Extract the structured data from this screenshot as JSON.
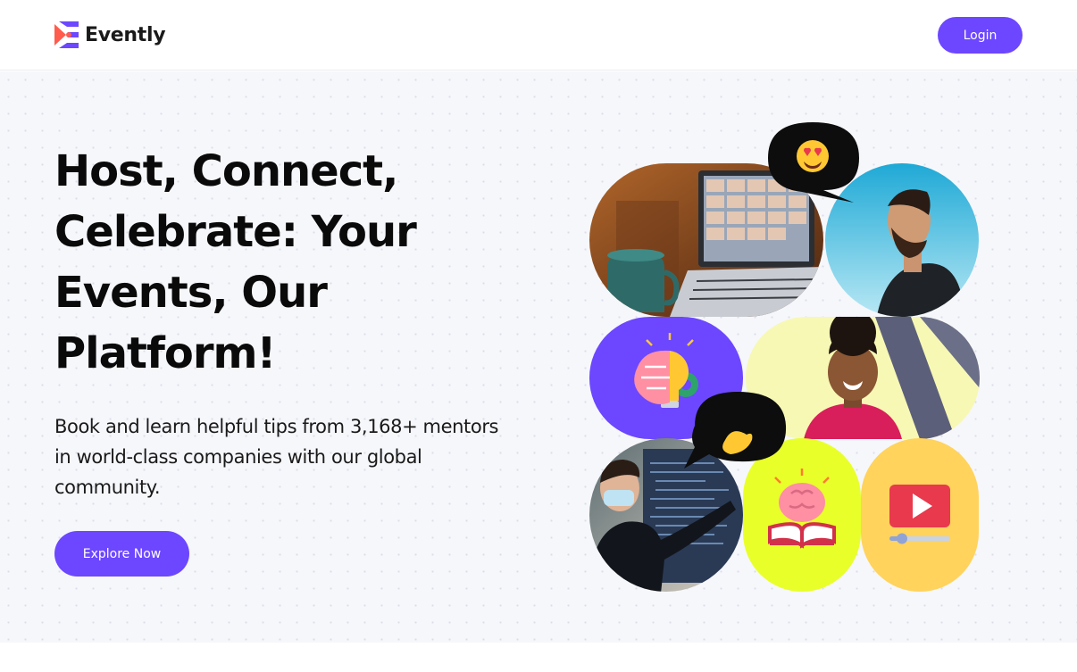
{
  "header": {
    "brand_name": "Evently",
    "login_label": "Login"
  },
  "hero": {
    "title": "Host, Connect, Celebrate: Your Events, Our Platform!",
    "subtitle": "Book and learn helpful tips from 3,168+ mentors in world-class companies with our global community.",
    "cta_label": "Explore Now"
  },
  "collage": {
    "tiles": [
      "photo-laptop-video-call",
      "photo-man-laughing",
      "brain-lightbulb-icon",
      "photo-woman-smiling",
      "photo-man-presenting",
      "brain-book-icon",
      "video-player-icon"
    ],
    "bubbles": [
      "heart-eyes-emoji",
      "pinched-fingers-emoji"
    ]
  },
  "colors": {
    "accent": "#6c47ff",
    "brand_red": "#ff5c4d",
    "brand_purple": "#6c47ff",
    "tile_purple": "#6c47ff",
    "tile_lime": "#e9ff2a",
    "tile_yellow": "#ffd35c",
    "tile_pale_yellow": "#f7f8b4",
    "tile_sky": "#2bbbe0",
    "bubble": "#0d0d0d"
  }
}
